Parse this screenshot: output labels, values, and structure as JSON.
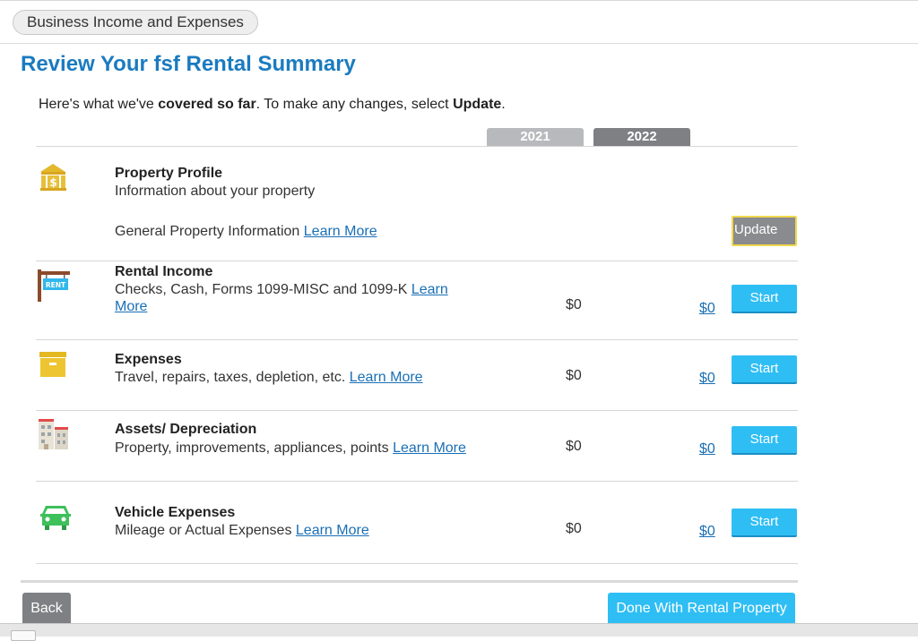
{
  "breadcrumb": {
    "label": "Business Income and Expenses"
  },
  "page": {
    "title": "Review Your fsf Rental Summary",
    "intro_pre": "Here's what we've ",
    "intro_bold1": "covered so far",
    "intro_mid": ". To make any changes, select ",
    "intro_bold2": "Update",
    "intro_end": "."
  },
  "years": {
    "y1": "2021",
    "y2": "2022"
  },
  "sections": {
    "profile": {
      "title": "Property Profile",
      "desc": "Information about your property",
      "sub_text": "General Property Information ",
      "link": "Learn More",
      "button": "Update",
      "icon": "building-dollar-icon"
    },
    "income": {
      "title": "Rental Income",
      "desc_line1": "Checks, Cash, Forms 1099-MISC and 1099-K ",
      "link_part1": "Learn",
      "link_part2": "More",
      "amt_2021": "$0",
      "amt_2022": "$0",
      "button": "Start",
      "icon": "rent-sign-icon"
    },
    "expenses": {
      "title": "Expenses",
      "desc": "Travel, repairs, taxes, depletion, etc. ",
      "link": "Learn More",
      "amt_2021": "$0",
      "amt_2022": "$0",
      "button": "Start",
      "icon": "box-icon"
    },
    "assets": {
      "title": "Assets/ Depreciation",
      "desc": "Property, improvements, appliances, points ",
      "link": "Learn More",
      "amt_2021": "$0",
      "amt_2022": "$0",
      "button": "Start",
      "icon": "buildings-icon"
    },
    "vehicle": {
      "title": "Vehicle Expenses",
      "desc": "Mileage or Actual Expenses ",
      "link": "Learn More",
      "amt_2021": "$0",
      "amt_2022": "$0",
      "button": "Start",
      "icon": "car-icon"
    }
  },
  "footer": {
    "back": "Back",
    "done": "Done With Rental Property"
  },
  "colors": {
    "accent": "#1a7bc0",
    "start_button": "#2fbef4",
    "update_border": "#f0d84c",
    "link": "#1a6fb5"
  }
}
